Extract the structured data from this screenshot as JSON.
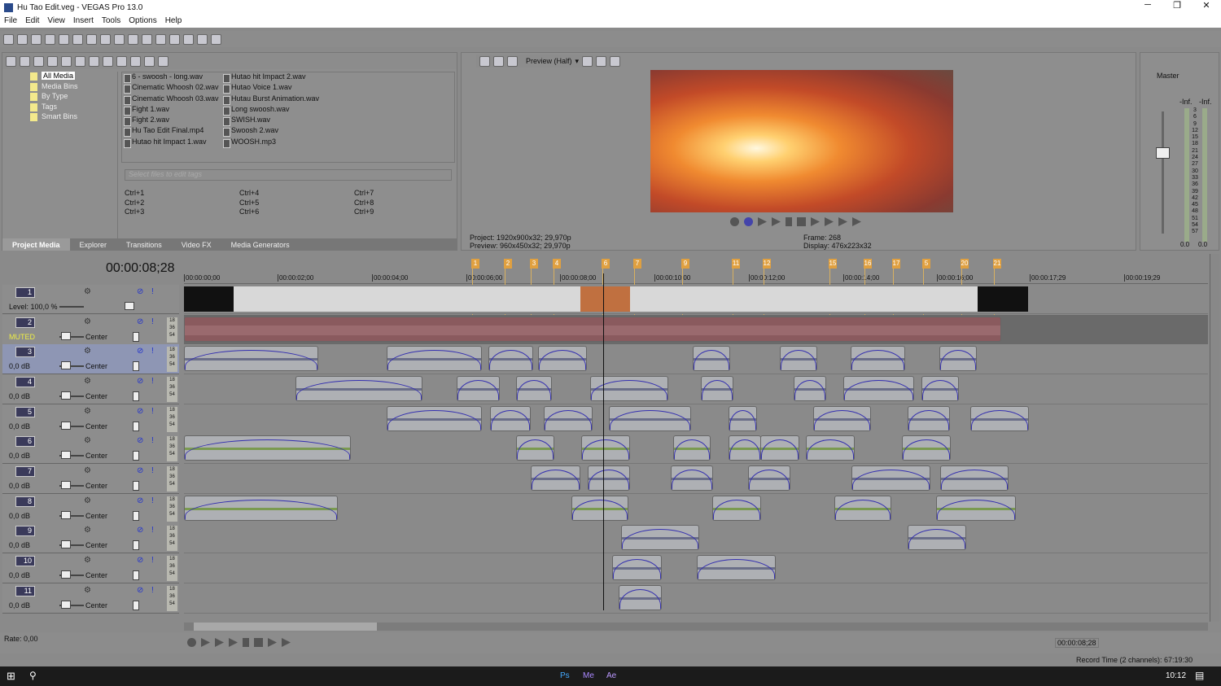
{
  "window": {
    "title": "Hu Tao Edit.veg - VEGAS Pro 13.0",
    "minimize": "─",
    "maximize": "❐",
    "close": "✕"
  },
  "menu": [
    "File",
    "Edit",
    "View",
    "Insert",
    "Tools",
    "Options",
    "Help"
  ],
  "media_tree": [
    "All Media",
    "Media Bins",
    "By Type",
    "Tags",
    "Smart Bins"
  ],
  "media_files": [
    "6 - swoosh - long.wav",
    "Cinematic Whoosh 02.wav",
    "Cinematic Whoosh 03.wav",
    "Fight 1.wav",
    "Fight 2.wav",
    "Hu Tao Edit Final.mp4",
    "Hutao hit Impact 1.wav",
    "Hutao hit Impact 2.wav",
    "Hutao Voice 1.wav",
    "Hutau Burst Animation.wav",
    "Long swoosh.wav",
    "SWISH.wav",
    "Swoosh 2.wav",
    "WOOSH.mp3"
  ],
  "tags_placeholder": "Select files to edit tags",
  "shortcuts": [
    "Ctrl+1",
    "Ctrl+4",
    "Ctrl+7",
    "Ctrl+2",
    "Ctrl+5",
    "Ctrl+8",
    "Ctrl+3",
    "Ctrl+6",
    "Ctrl+9"
  ],
  "panel_tabs": [
    "Project Media",
    "Explorer",
    "Transitions",
    "Video FX",
    "Media Generators"
  ],
  "preview": {
    "mode": "Preview (Half)",
    "project_label": "Project:",
    "project": "1920x900x32; 29,970p",
    "preview_label": "Preview:",
    "preview_val": "960x450x32; 29,970p",
    "frame_label": "Frame:",
    "frame": "268",
    "display_label": "Display:",
    "display": "476x223x32"
  },
  "master": {
    "label": "Master",
    "inf_l": "-Inf.",
    "inf_r": "-Inf.",
    "scale": [
      "3",
      "6",
      "9",
      "12",
      "15",
      "18",
      "21",
      "24",
      "27",
      "30",
      "33",
      "36",
      "39",
      "42",
      "45",
      "48",
      "51",
      "54",
      "57"
    ],
    "val_l": "0.0",
    "val_r": "0.0"
  },
  "timeline": {
    "timecode": "00:00:08;28",
    "ruler": [
      "00:00:00;00",
      "00:00:02;00",
      "00:00:04;00",
      "00:00:06;00",
      "00:00:08;00",
      "00:00:10;00",
      "00:00:12;00",
      "00:00:14;00",
      "00:00:16;00",
      "00:00:17;29",
      "00:00:19;29"
    ],
    "markers": [
      "1",
      "2",
      "3",
      "4",
      "6",
      "7",
      "9",
      "11",
      "12",
      "15",
      "16",
      "17",
      "5",
      "20",
      "21"
    ]
  },
  "tracks": [
    {
      "num": "1",
      "label": "Level: 100,0 %"
    },
    {
      "num": "2",
      "label": "MUTED",
      "pan": "Center"
    },
    {
      "num": "3",
      "label": "0,0 dB",
      "pan": "Center"
    },
    {
      "num": "4",
      "label": "0,0 dB",
      "pan": "Center"
    },
    {
      "num": "5",
      "label": "0,0 dB",
      "pan": "Center"
    },
    {
      "num": "6",
      "label": "0,0 dB",
      "pan": "Center"
    },
    {
      "num": "7",
      "label": "0,0 dB",
      "pan": "Center"
    },
    {
      "num": "8",
      "label": "0,0 dB",
      "pan": "Center"
    },
    {
      "num": "9",
      "label": "0,0 dB",
      "pan": "Center"
    },
    {
      "num": "10",
      "label": "0,0 dB",
      "pan": "Center"
    },
    {
      "num": "11",
      "label": "0,0 dB",
      "pan": "Center"
    }
  ],
  "meter_scale": [
    "18",
    "36",
    "54"
  ],
  "bottom": {
    "rate": "Rate: 0,00",
    "cursor_time": "00:00:08;28",
    "record_time": "Record Time (2 channels): 67:19:30"
  },
  "taskbar": {
    "clock": "10:12",
    "apps": [
      "Ps",
      "Me",
      "Ae"
    ]
  }
}
